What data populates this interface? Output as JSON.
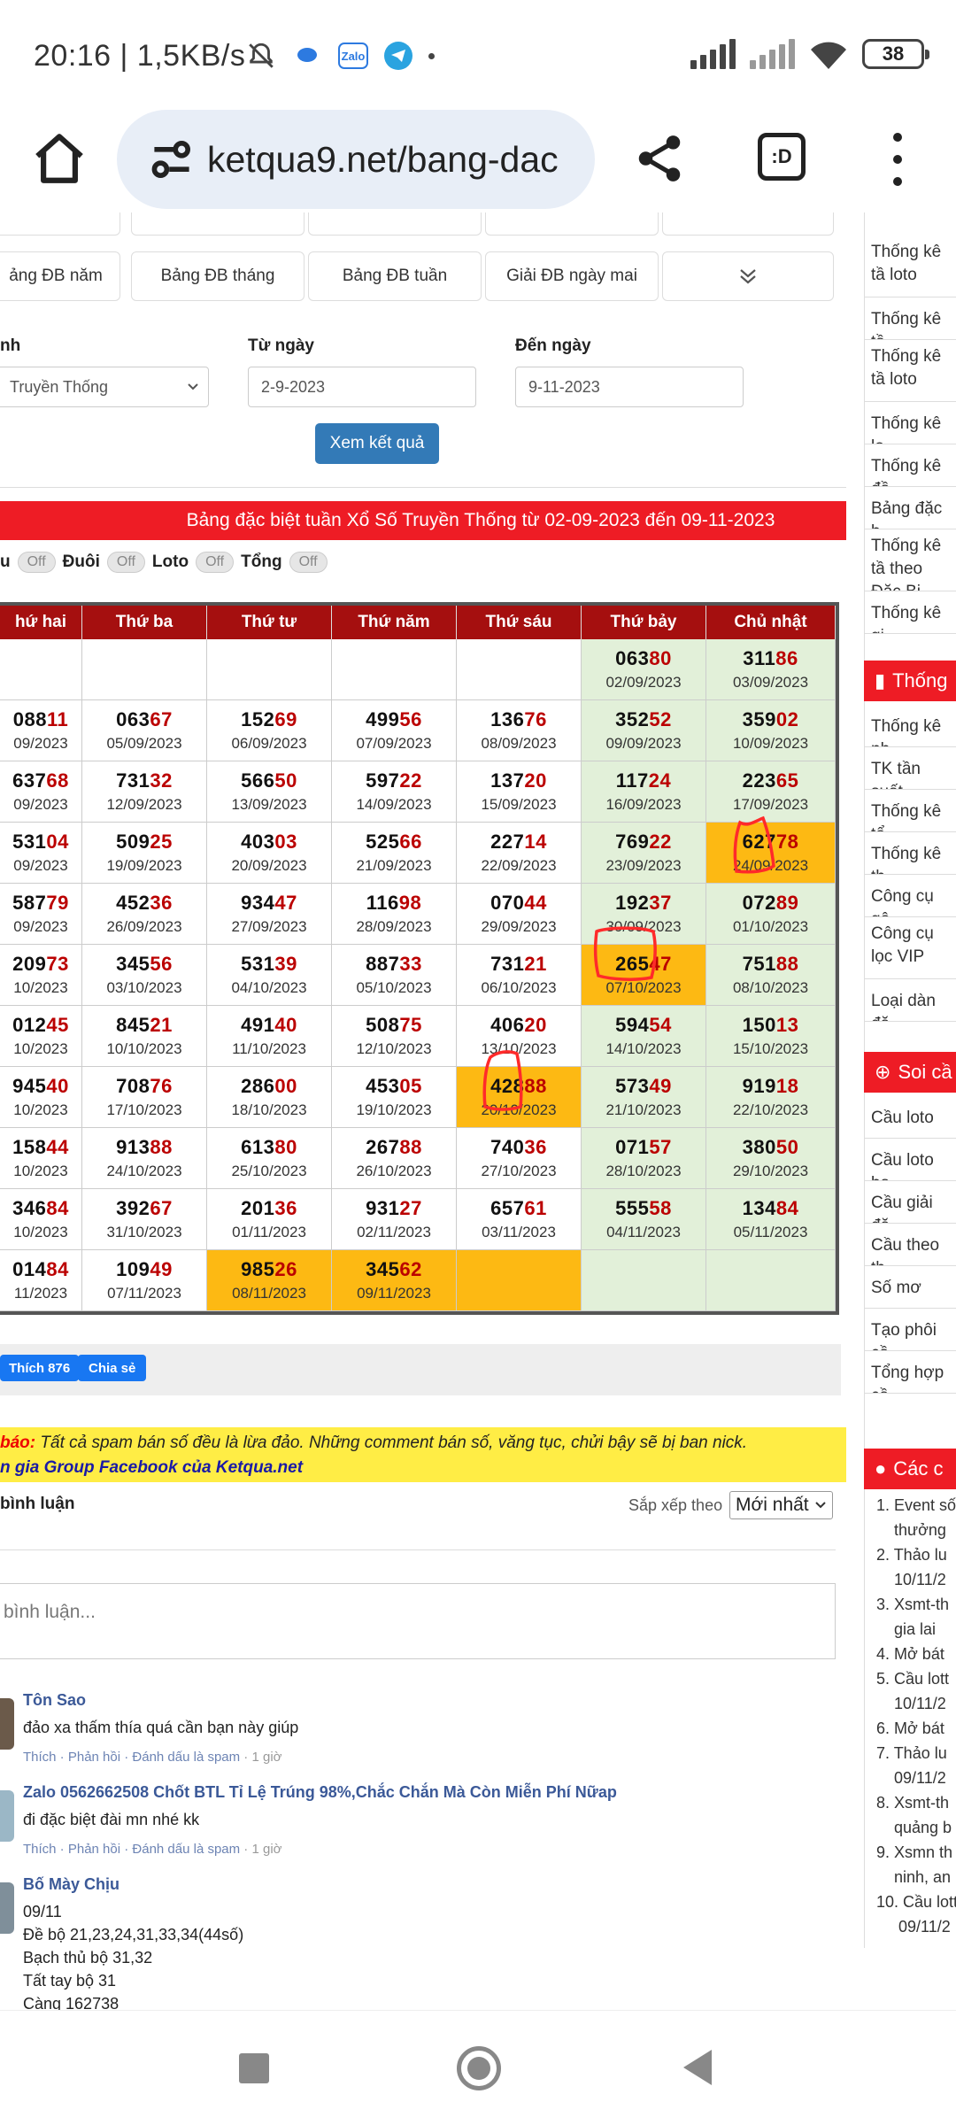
{
  "status": {
    "time": "20:16 | 1,5KB/s",
    "battery": "38"
  },
  "browser": {
    "url": "ketqua9.net/bang-dac",
    "tab_label": ":D"
  },
  "quick_buttons": [
    "ảng ĐB năm",
    "Bảng ĐB tháng",
    "Bảng ĐB tuần",
    "Giải ĐB ngày mai"
  ],
  "form": {
    "province_label": "nh",
    "province_value": "Truyền Thống",
    "from_label": "Từ ngày",
    "from_value": "2-9-2023",
    "to_label": "Đến ngày",
    "to_value": "9-11-2023",
    "submit": "Xem kết quả"
  },
  "banner": "Bảng đặc biệt tuần Xổ Số Truyền Thống từ 02-09-2023 đến 09-11-2023",
  "toggles": {
    "t0": "u",
    "t1": "Đuôi",
    "t2": "Loto",
    "t3": "Tổng",
    "off": "Off"
  },
  "table": {
    "headers": [
      "hứ hai",
      "Thứ ba",
      "Thứ tư",
      "Thứ năm",
      "Thứ sáu",
      "Thứ bảy",
      "Chủ nhật"
    ],
    "rows": [
      [
        {
          "h": "",
          "t": "",
          "d": ""
        },
        {
          "h": "",
          "t": "",
          "d": ""
        },
        {
          "h": "",
          "t": "",
          "d": ""
        },
        {
          "h": "",
          "t": "",
          "d": ""
        },
        {
          "h": "",
          "t": "",
          "d": ""
        },
        {
          "h": "063",
          "t": "80",
          "d": "02/09/2023"
        },
        {
          "h": "311",
          "t": "86",
          "d": "03/09/2023"
        }
      ],
      [
        {
          "h": "088",
          "t": "11",
          "d": "09/2023"
        },
        {
          "h": "063",
          "t": "67",
          "d": "05/09/2023"
        },
        {
          "h": "152",
          "t": "69",
          "d": "06/09/2023"
        },
        {
          "h": "499",
          "t": "56",
          "d": "07/09/2023"
        },
        {
          "h": "136",
          "t": "76",
          "d": "08/09/2023"
        },
        {
          "h": "352",
          "t": "52",
          "d": "09/09/2023"
        },
        {
          "h": "359",
          "t": "02",
          "d": "10/09/2023"
        }
      ],
      [
        {
          "h": "637",
          "t": "68",
          "d": "09/2023"
        },
        {
          "h": "731",
          "t": "32",
          "d": "12/09/2023"
        },
        {
          "h": "566",
          "t": "50",
          "d": "13/09/2023"
        },
        {
          "h": "597",
          "t": "22",
          "d": "14/09/2023"
        },
        {
          "h": "137",
          "t": "20",
          "d": "15/09/2023"
        },
        {
          "h": "117",
          "t": "24",
          "d": "16/09/2023"
        },
        {
          "h": "223",
          "t": "65",
          "d": "17/09/2023"
        }
      ],
      [
        {
          "h": "531",
          "t": "04",
          "d": "09/2023"
        },
        {
          "h": "509",
          "t": "25",
          "d": "19/09/2023"
        },
        {
          "h": "403",
          "t": "03",
          "d": "20/09/2023"
        },
        {
          "h": "525",
          "t": "66",
          "d": "21/09/2023"
        },
        {
          "h": "227",
          "t": "14",
          "d": "22/09/2023"
        },
        {
          "h": "769",
          "t": "22",
          "d": "23/09/2023"
        },
        {
          "h": "627",
          "t": "78",
          "d": "24/09/2023"
        }
      ],
      [
        {
          "h": "587",
          "t": "79",
          "d": "09/2023"
        },
        {
          "h": "452",
          "t": "36",
          "d": "26/09/2023"
        },
        {
          "h": "934",
          "t": "47",
          "d": "27/09/2023"
        },
        {
          "h": "116",
          "t": "98",
          "d": "28/09/2023"
        },
        {
          "h": "070",
          "t": "44",
          "d": "29/09/2023"
        },
        {
          "h": "192",
          "t": "37",
          "d": "30/09/2023"
        },
        {
          "h": "072",
          "t": "89",
          "d": "01/10/2023"
        }
      ],
      [
        {
          "h": "209",
          "t": "73",
          "d": "10/2023"
        },
        {
          "h": "345",
          "t": "56",
          "d": "03/10/2023"
        },
        {
          "h": "531",
          "t": "39",
          "d": "04/10/2023"
        },
        {
          "h": "887",
          "t": "33",
          "d": "05/10/2023"
        },
        {
          "h": "731",
          "t": "21",
          "d": "06/10/2023"
        },
        {
          "h": "265",
          "t": "47",
          "d": "07/10/2023"
        },
        {
          "h": "751",
          "t": "88",
          "d": "08/10/2023"
        }
      ],
      [
        {
          "h": "012",
          "t": "45",
          "d": "10/2023"
        },
        {
          "h": "845",
          "t": "21",
          "d": "10/10/2023"
        },
        {
          "h": "491",
          "t": "40",
          "d": "11/10/2023"
        },
        {
          "h": "508",
          "t": "75",
          "d": "12/10/2023"
        },
        {
          "h": "406",
          "t": "20",
          "d": "13/10/2023"
        },
        {
          "h": "594",
          "t": "54",
          "d": "14/10/2023"
        },
        {
          "h": "150",
          "t": "13",
          "d": "15/10/2023"
        }
      ],
      [
        {
          "h": "945",
          "t": "40",
          "d": "10/2023"
        },
        {
          "h": "708",
          "t": "76",
          "d": "17/10/2023"
        },
        {
          "h": "286",
          "t": "00",
          "d": "18/10/2023"
        },
        {
          "h": "453",
          "t": "05",
          "d": "19/10/2023"
        },
        {
          "h": "428",
          "t": "88",
          "d": "20/10/2023"
        },
        {
          "h": "573",
          "t": "49",
          "d": "21/10/2023"
        },
        {
          "h": "919",
          "t": "18",
          "d": "22/10/2023"
        }
      ],
      [
        {
          "h": "158",
          "t": "44",
          "d": "10/2023"
        },
        {
          "h": "913",
          "t": "88",
          "d": "24/10/2023"
        },
        {
          "h": "613",
          "t": "80",
          "d": "25/10/2023"
        },
        {
          "h": "267",
          "t": "88",
          "d": "26/10/2023"
        },
        {
          "h": "740",
          "t": "36",
          "d": "27/10/2023"
        },
        {
          "h": "071",
          "t": "57",
          "d": "28/10/2023"
        },
        {
          "h": "380",
          "t": "50",
          "d": "29/10/2023"
        }
      ],
      [
        {
          "h": "346",
          "t": "84",
          "d": "10/2023"
        },
        {
          "h": "392",
          "t": "67",
          "d": "31/10/2023"
        },
        {
          "h": "201",
          "t": "36",
          "d": "01/11/2023"
        },
        {
          "h": "931",
          "t": "27",
          "d": "02/11/2023"
        },
        {
          "h": "657",
          "t": "61",
          "d": "03/11/2023"
        },
        {
          "h": "555",
          "t": "58",
          "d": "04/11/2023"
        },
        {
          "h": "134",
          "t": "84",
          "d": "05/11/2023"
        }
      ],
      [
        {
          "h": "014",
          "t": "84",
          "d": "11/2023"
        },
        {
          "h": "109",
          "t": "49",
          "d": "07/11/2023"
        },
        {
          "h": "985",
          "t": "26",
          "d": "08/11/2023"
        },
        {
          "h": "345",
          "t": "62",
          "d": "09/11/2023"
        },
        {
          "h": "",
          "t": "",
          "d": ""
        },
        {
          "h": "",
          "t": "",
          "d": ""
        },
        {
          "h": "",
          "t": "",
          "d": ""
        }
      ]
    ],
    "highlight": {
      "orange": [
        "3-6",
        "5-5",
        "7-4",
        "10-2",
        "10-3",
        "10-4"
      ],
      "green_cols": [
        5,
        6
      ]
    }
  },
  "social": {
    "like": "Thích 876",
    "share": "Chia sẻ"
  },
  "warning": {
    "prefix": "báo:",
    "text": "Tất cả spam bán số đều là lừa đảo. Những comment bán số, văng tục, chửi bậy sẽ bị ban nick.",
    "line2": "n gia Group Facebook của Ketqua.net"
  },
  "comments_head": {
    "count": "bình luận",
    "sort_label": "Sắp xếp theo",
    "sort_value": "Mới nhất"
  },
  "comment_placeholder": "bình luận...",
  "comments": [
    {
      "name": "Tôn Sao",
      "lines": [
        "đảo xa thấm thía quá cần bạn này giúp"
      ],
      "meta": "Thích · Phản hồi · Đánh dấu là spam",
      "time": " · 1 giờ"
    },
    {
      "name": "Zalo 0562662508 Chốt BTL Tỉ Lệ Trúng 98%,Chắc Chắn Mà Còn Miễn Phí Nữap",
      "lines": [
        "đi đặc biệt đài mn nhé kk"
      ],
      "meta": "Thích · Phản hồi · Đánh dấu là spam",
      "time": " · 1 giờ"
    },
    {
      "name": "Bố Mày Chịu",
      "lines": [
        "09/11",
        "Đề bộ 21,23,24,31,33,34(44số)",
        "Bạch thủ bộ 31,32",
        "Tất tay bộ 31",
        "Càng 162738"
      ],
      "meta": "",
      "time": ""
    }
  ],
  "sidebar": {
    "items1": [
      "Thống kê tầ loto",
      "Thống kê tầ",
      "Thống kê tầ loto",
      "Thống kê lo",
      "Thống kê đầ",
      "Bảng đặc b",
      "Thống kê tầ theo Đặc Bi",
      "Thống kê gi"
    ],
    "head1": "Thống",
    "items2": [
      "Thống kê nh",
      "TK tần suất",
      "Thống kê tổ",
      "Thống kê th",
      "Công cụ gộ",
      "Công cụ lọc VIP",
      "Loại dàn đặ"
    ],
    "head2": "Soi cầ",
    "items3": [
      "Cầu loto",
      "Cầu loto bạ",
      "Cầu giải đặ",
      "Cầu theo th",
      "Số mơ",
      "Tạo phôi cầ",
      "Tổng hợp cầ"
    ],
    "head3": "Các c",
    "list": [
      "1. Event số",
      "    thưởng",
      "2. Thảo lu",
      "    10/11/2",
      "3. Xsmt-th",
      "    gia lai",
      "4. Mở bát",
      "5. Cầu lott",
      "    10/11/2",
      "6. Mở bát",
      "7. Thảo lu",
      "    09/11/2",
      "8. Xsmt-th",
      "    quảng b",
      "9. Xsmn th",
      "    ninh, an",
      "10. Cầu lott",
      "     09/11/2"
    ]
  }
}
